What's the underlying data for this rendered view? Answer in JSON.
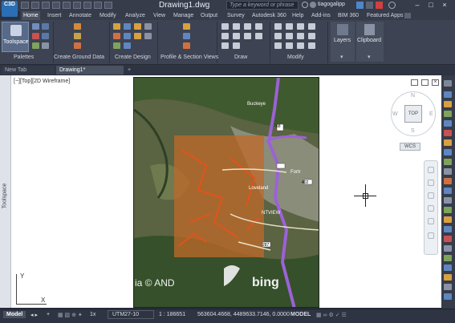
{
  "app": {
    "logo_text": "C3D",
    "document_title": "Drawing1.dwg",
    "search_placeholder": "Type a keyword or phrase",
    "user": "tiagogalipp"
  },
  "ribbon_tabs": [
    "Home",
    "Insert",
    "Annotate",
    "Modify",
    "Analyze",
    "View",
    "Manage",
    "Output",
    "Survey",
    "Autodesk 360",
    "Help",
    "Add-ins",
    "BIM 360",
    "Featured Apps"
  ],
  "active_tab": "Home",
  "ribbon": {
    "toolspace_label": "Toolspace",
    "panels": [
      "Palettes",
      "Create Ground Data",
      "Create Design",
      "Profile & Section Views",
      "Draw",
      "Modify"
    ],
    "layers_label": "Layers",
    "clipboard_label": "Clipboard"
  },
  "doc_tabs": {
    "new_tab": "New Tab",
    "drawing_tab": "Drawing1*",
    "plus": "+"
  },
  "canvas": {
    "viewport_label": "[−][Top][2D Wireframe]",
    "toolspace_side_label": "Toolspace",
    "viewcube_face": "TOP",
    "compass_n": "N",
    "compass_w": "W",
    "compass_e": "E",
    "compass_s": "S",
    "wcs_label": "WCS",
    "ucs_y": "Y",
    "ucs_x": "X"
  },
  "map": {
    "copyright": "ia © AND",
    "provider": "bing",
    "places": [
      "Buckeye",
      "NTVIEW",
      "Fortr",
      "Loveland"
    ],
    "road_labels": [
      "68",
      "402",
      "287"
    ]
  },
  "statusbar": {
    "model_tab": "Model",
    "coord_system": "UTM27-10",
    "scale": "1 : 186651",
    "coordinates": "563604.4668, 4489633.7146, 0.0000",
    "model_space": "MODEL",
    "lineweight": "1x"
  },
  "colors": {
    "ribbon_bg": "#3d4352",
    "accent_blue": "#2a6fb5",
    "map_overlay": "#c06a2a",
    "road_purple": "#9b62d6"
  }
}
